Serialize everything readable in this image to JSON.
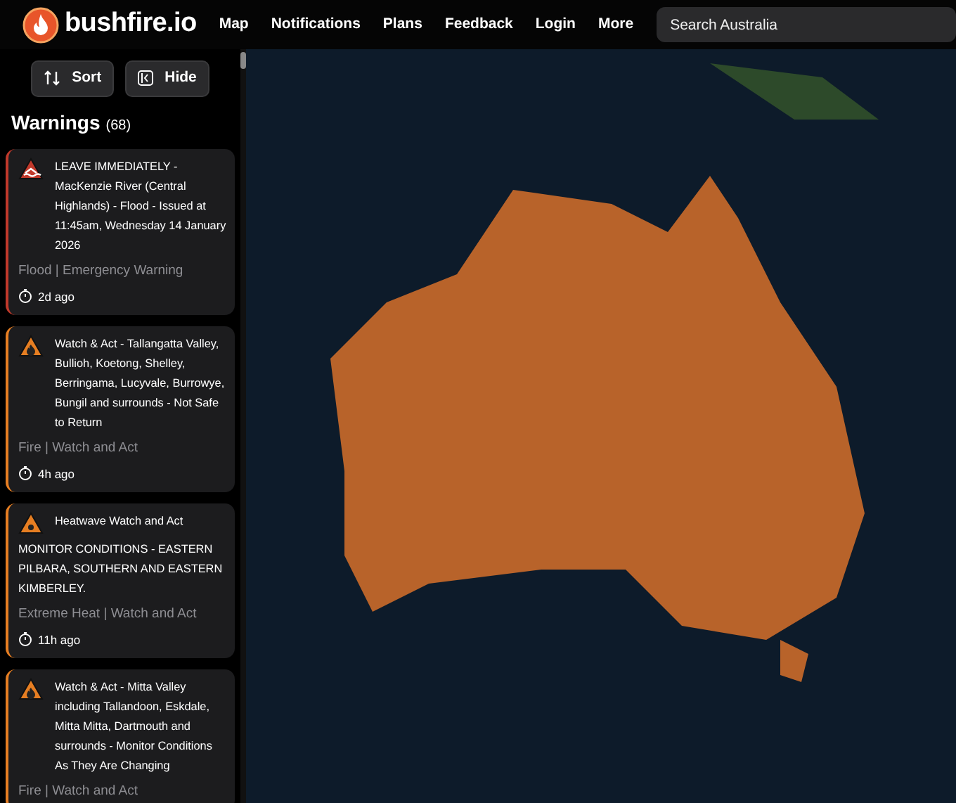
{
  "header": {
    "brand": "bushfire.io",
    "nav": [
      {
        "label": "Map",
        "selected": false
      },
      {
        "label": "Notifications",
        "selected": false
      },
      {
        "label": "Plans",
        "selected": false
      },
      {
        "label": "Feedback",
        "selected": false
      },
      {
        "label": "Login",
        "selected": false
      },
      {
        "label": "More",
        "selected": false
      }
    ],
    "search": {
      "placeholder": "Search Australia"
    }
  },
  "toolbar": {
    "buttons": [
      {
        "kind": "sort",
        "label": "Sort"
      },
      {
        "kind": "hide",
        "label": "Hide"
      }
    ]
  },
  "warnings": {
    "title": "Warnings",
    "count": "(68)",
    "items": [
      {
        "kind": "flood",
        "color": "#c0392b",
        "headline": "LEAVE IMMEDIATELY - MacKenzie River (Central Highlands) - Flood - Issued at 11:45am, Wednesday 14 January 2026",
        "category": "Flood | Emergency Warning",
        "time": "2d ago"
      },
      {
        "kind": "fire",
        "color": "#e67e22",
        "headline": "Watch & Act - Tallangatta Valley, Bullioh, Koetong, Shelley, Berringama, Lucyvale, Burrowye, Bungil and surrounds - Not Safe to Return",
        "category": "Fire | Watch and Act",
        "time": "4h ago"
      },
      {
        "kind": "heat",
        "color": "#e67e22",
        "headline": "Heatwave Watch and Act",
        "body": "MONITOR CONDITIONS - EASTERN PILBARA, SOUTHERN AND EASTERN KIMBERLEY.",
        "category": "Extreme Heat | Watch and Act",
        "time": "11h ago"
      },
      {
        "kind": "fire",
        "color": "#e67e22",
        "headline": "Watch & Act - Mitta Valley including Tallandoon, Eskdale, Mitta Mitta, Dartmouth and surrounds - Monitor Conditions As They Are Changing",
        "category": "Fire | Watch and Act"
      }
    ]
  }
}
